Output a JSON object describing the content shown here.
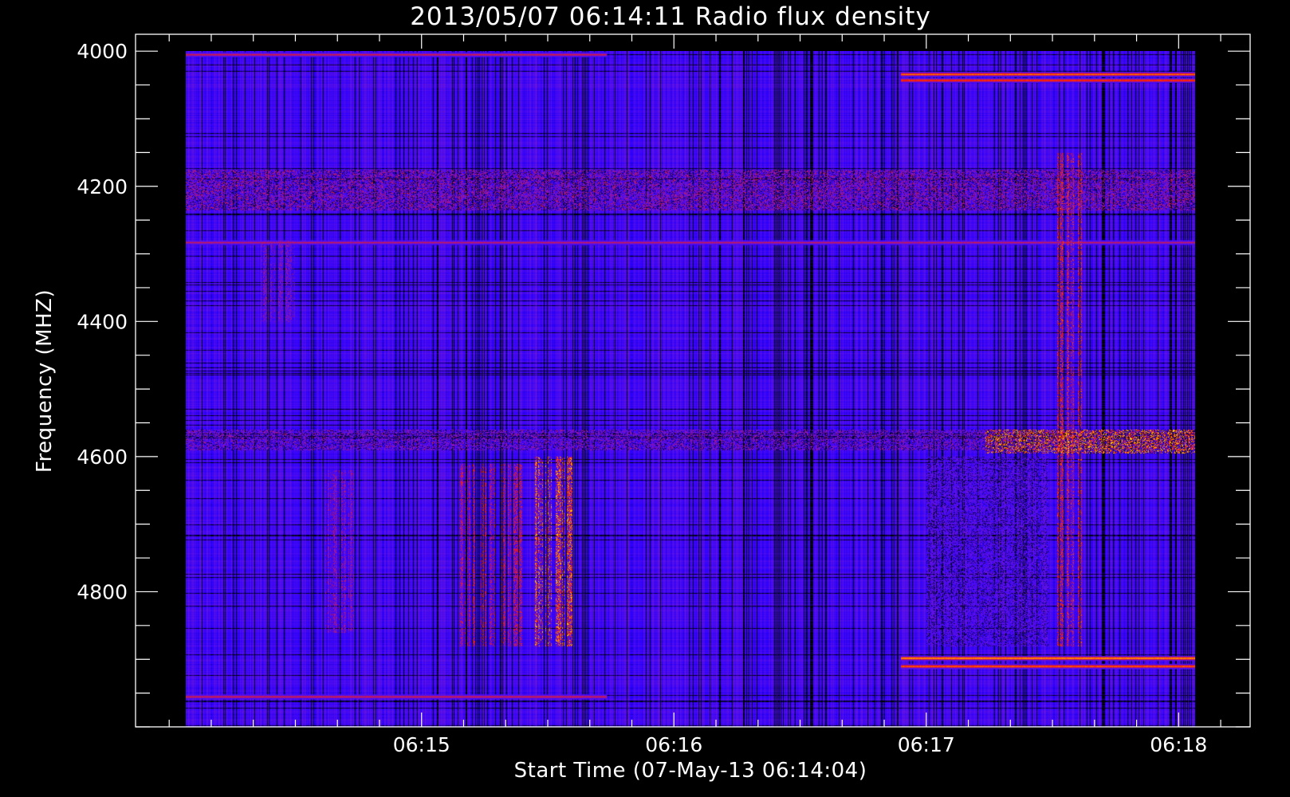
{
  "chart_data": {
    "type": "heatmap",
    "title": "2013/05/07 06:14:11 Radio flux density",
    "xlabel": "Start Time (07-May-13 06:14:04)",
    "ylabel": "Frequency (MHZ)",
    "x_tick_labels": [
      "06:15",
      "06:16",
      "06:17",
      "06:18"
    ],
    "x_tick_seconds": [
      56,
      116,
      176,
      236
    ],
    "xlim_seconds": [
      -12,
      253
    ],
    "data_x_range_seconds": [
      0,
      240
    ],
    "y_tick_labels": [
      "4000",
      "4200",
      "4400",
      "4600",
      "4800"
    ],
    "y_tick_values": [
      4000,
      4200,
      4400,
      4600,
      4800
    ],
    "ylim": [
      3975,
      5000
    ],
    "data_y_range": [
      4000,
      5000
    ],
    "y_reversed": true,
    "colormap": [
      "#000000",
      "#2a00ff",
      "#6614e0",
      "#ff1a00",
      "#ffd400"
    ],
    "background_color": "#2b1aee",
    "features": [
      {
        "kind": "horizontal-band",
        "freq": [
          4175,
          4235
        ],
        "t": [
          0,
          240
        ],
        "intensity": 0.55
      },
      {
        "kind": "horizontal-line",
        "freq": 4283,
        "t": [
          0,
          240
        ],
        "intensity": 0.65
      },
      {
        "kind": "horizontal-band",
        "freq": [
          4560,
          4590
        ],
        "t": [
          0,
          240
        ],
        "intensity": 0.5
      },
      {
        "kind": "horizontal-band",
        "freq": [
          4560,
          4595
        ],
        "t": [
          190,
          240
        ],
        "intensity": 0.85
      },
      {
        "kind": "horizontal-line",
        "freq": 4034,
        "t": [
          170,
          240
        ],
        "intensity": 0.9
      },
      {
        "kind": "horizontal-line",
        "freq": 4043,
        "t": [
          170,
          240
        ],
        "intensity": 0.85
      },
      {
        "kind": "horizontal-line",
        "freq": 4898,
        "t": [
          170,
          240
        ],
        "intensity": 1.0
      },
      {
        "kind": "horizontal-line",
        "freq": 4910,
        "t": [
          170,
          240
        ],
        "intensity": 0.9
      },
      {
        "kind": "horizontal-line",
        "freq": 4005,
        "t": [
          0,
          100
        ],
        "intensity": 0.7
      },
      {
        "kind": "horizontal-line",
        "freq": 4955,
        "t": [
          0,
          100
        ],
        "intensity": 0.7
      },
      {
        "kind": "vertical-burst",
        "freq": [
          4610,
          4880
        ],
        "t": [
          65,
          80
        ],
        "intensity": 0.65
      },
      {
        "kind": "vertical-burst",
        "freq": [
          4600,
          4880
        ],
        "t": [
          83,
          92
        ],
        "intensity": 0.85
      },
      {
        "kind": "vertical-burst",
        "freq": [
          4620,
          4860
        ],
        "t": [
          33,
          40
        ],
        "intensity": 0.55
      },
      {
        "kind": "vertical-burst",
        "freq": [
          4150,
          4880
        ],
        "t": [
          207,
          213
        ],
        "intensity": 0.7
      },
      {
        "kind": "vertical-burst",
        "freq": [
          4280,
          4400
        ],
        "t": [
          18,
          26
        ],
        "intensity": 0.5
      },
      {
        "kind": "horizontal-band",
        "freq": [
          4600,
          4880
        ],
        "t": [
          176,
          205
        ],
        "intensity": 0.4
      }
    ]
  }
}
